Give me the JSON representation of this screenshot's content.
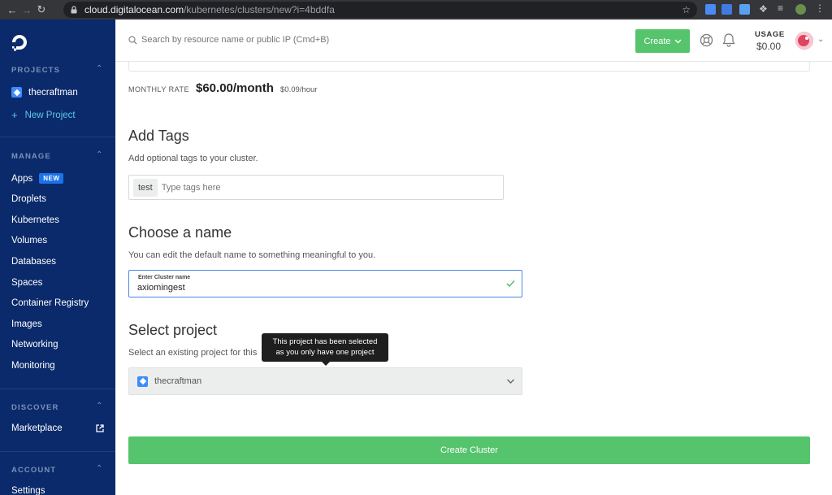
{
  "browser": {
    "url_host": "cloud.digitalocean.com",
    "url_path": "/kubernetes/clusters/new?i=4bddfa"
  },
  "sidebar": {
    "projects_title": "PROJECTS",
    "project_name": "thecraftman",
    "new_project": "New Project",
    "manage_title": "MANAGE",
    "manage_items": [
      "Apps",
      "Droplets",
      "Kubernetes",
      "Volumes",
      "Databases",
      "Spaces",
      "Container Registry",
      "Images",
      "Networking",
      "Monitoring"
    ],
    "apps_badge": "NEW",
    "discover_title": "DISCOVER",
    "marketplace": "Marketplace",
    "account_title": "ACCOUNT",
    "settings": "Settings"
  },
  "header": {
    "search_placeholder": "Search by resource name or public IP (Cmd+B)",
    "create_label": "Create",
    "usage_label": "USAGE",
    "usage_value": "$0.00"
  },
  "rate": {
    "label": "MONTHLY RATE",
    "monthly": "$60.00/month",
    "hourly": "$0.09/hour"
  },
  "tags": {
    "title": "Add Tags",
    "subtitle": "Add optional tags to your cluster.",
    "chip": "test",
    "placeholder": "Type tags here"
  },
  "name": {
    "title": "Choose a name",
    "subtitle": "You can edit the default name to something meaningful to you.",
    "field_label": "Enter Cluster name",
    "value": "axiomingest"
  },
  "project": {
    "title": "Select project",
    "subtitle": "Select an existing project for this",
    "tooltip_line1": "This project has been selected",
    "tooltip_line2": "as you only have one project",
    "selected": "thecraftman"
  },
  "submit": {
    "label": "Create Cluster"
  },
  "colors": {
    "sidebar_bg": "#0a2a6b",
    "accent_green": "#55c46c",
    "focus_blue": "#4a87e8"
  }
}
